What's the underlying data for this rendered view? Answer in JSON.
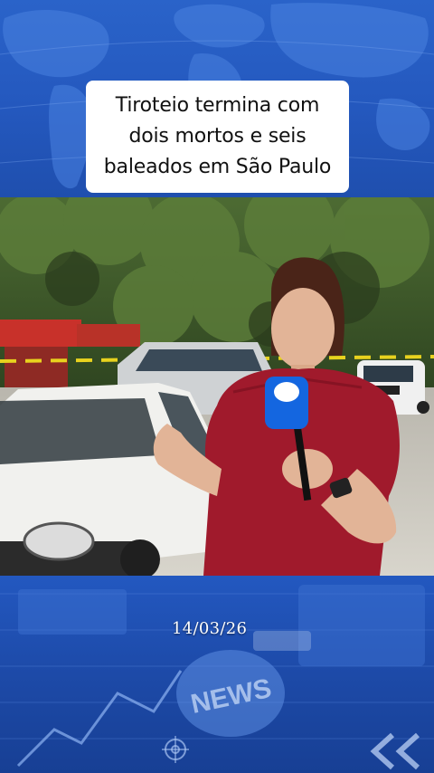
{
  "headline": "Tiroteio termina com\ndois mortos e seis\nbaleados em São Paulo",
  "date": "14/03/26",
  "news_badge": "NEWS",
  "colors": {
    "background_blue": "#1f4fb0",
    "headline_box": "#ffffff",
    "jacket_red": "#a01a2c",
    "microphone_blue": "#1466e0"
  },
  "icons": {
    "top_map": "world-map-icon",
    "bottom_badge": "news-icon",
    "bottom_target": "crosshair-icon",
    "bottom_arrows": "double-chevron-left-icon"
  }
}
